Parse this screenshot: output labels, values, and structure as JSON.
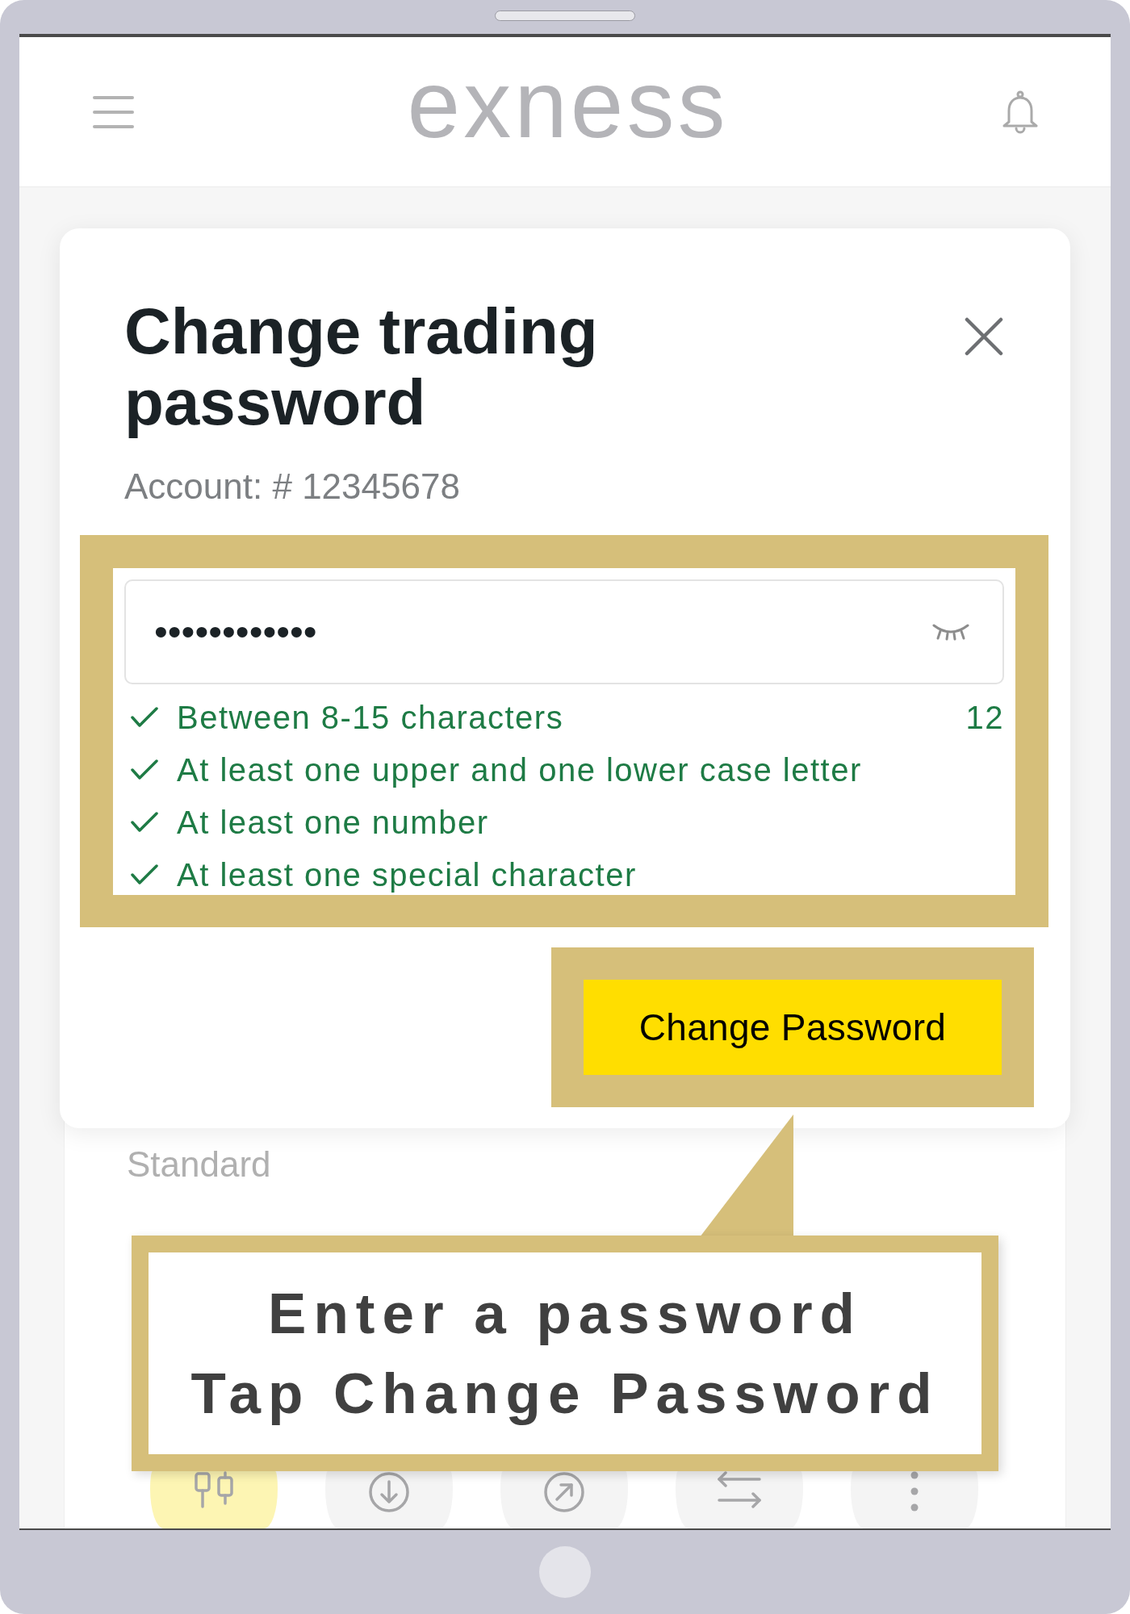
{
  "header": {
    "logo": "exness"
  },
  "dialog": {
    "title": "Change trading password",
    "account": "Account: # 12345678",
    "password": {
      "value": "••••••••••••",
      "visible": false
    },
    "rules": [
      {
        "text": "Between 8-15 characters",
        "met": true,
        "count": "12"
      },
      {
        "text": "At least one upper and one lower case letter",
        "met": true
      },
      {
        "text": "At least one number",
        "met": true
      },
      {
        "text": "At least one special character",
        "met": true
      }
    ],
    "submit": "Change Password"
  },
  "account_card": {
    "account_type": "Standard"
  },
  "callout": {
    "lines": [
      "Enter a password",
      "Tap Change Password"
    ]
  },
  "bottom_nav": [
    {
      "kind": "trade",
      "selected": true
    },
    {
      "kind": "deposit",
      "selected": false
    },
    {
      "kind": "withdraw",
      "selected": false
    },
    {
      "kind": "transfer",
      "selected": false
    },
    {
      "kind": "more",
      "selected": false
    }
  ]
}
